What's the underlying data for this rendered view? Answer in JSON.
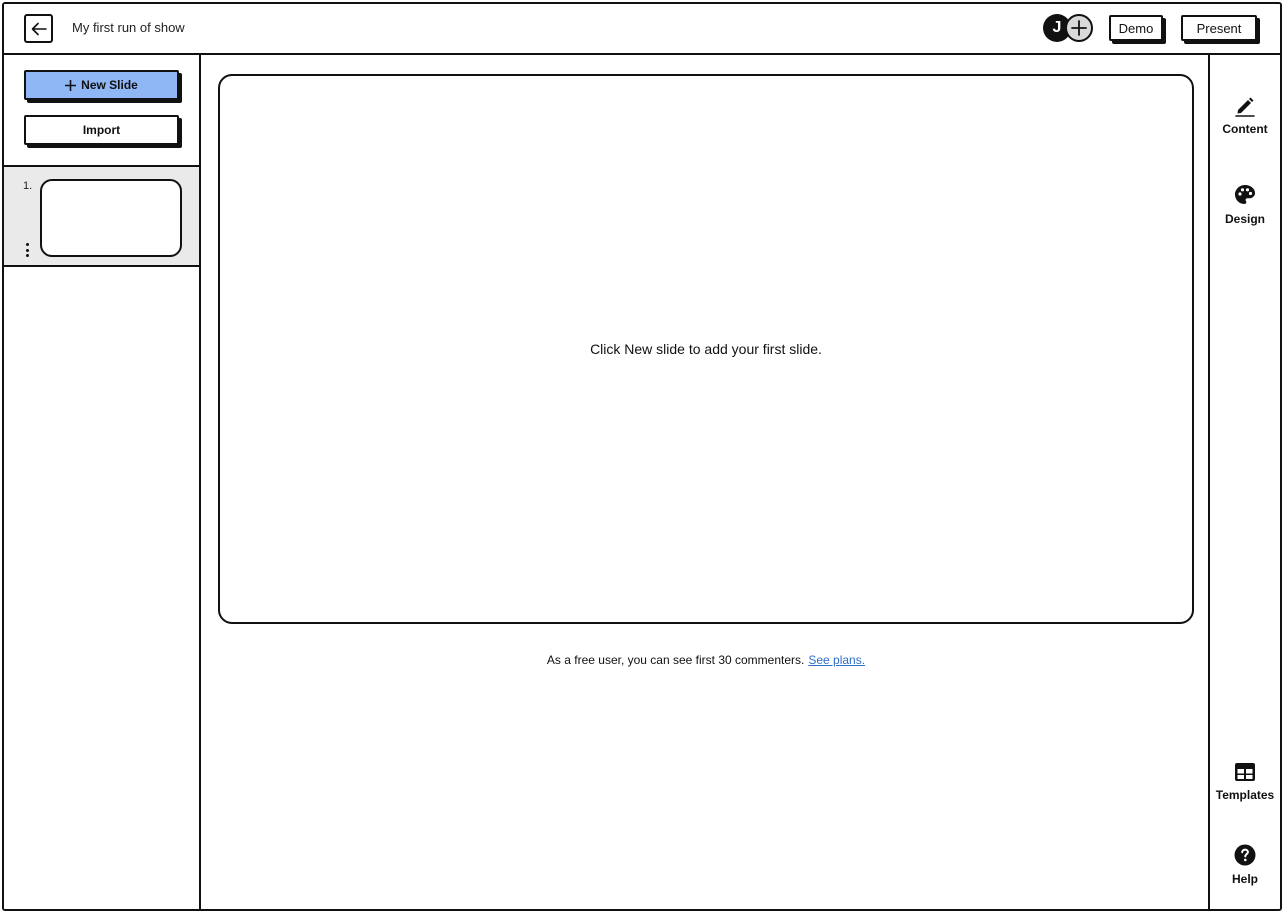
{
  "header": {
    "title": "My first run of show",
    "avatar_initial": "J",
    "demo_label": "Demo",
    "present_label": "Present"
  },
  "sidebar": {
    "new_slide_label": "New Slide",
    "import_label": "Import",
    "slides": [
      {
        "number": "1."
      }
    ]
  },
  "canvas": {
    "empty_message": "Click New slide to add your first slide."
  },
  "footer": {
    "note": "As a free user, you can see first 30 commenters.",
    "link_label": "See plans."
  },
  "rail": {
    "content_label": "Content",
    "design_label": "Design",
    "templates_label": "Templates",
    "help_label": "Help"
  },
  "colors": {
    "accent": "#8fb6f5",
    "link": "#2f6fc7",
    "ink": "#111111",
    "selected_row": "#eaeaea"
  },
  "icons": {
    "back": "arrow-left-icon",
    "add_user": "plus-circle-icon",
    "new_slide": "plus-icon",
    "content": "pencil-icon",
    "design": "palette-icon",
    "templates": "table-icon",
    "help": "question-circle-icon",
    "slide_menu": "kebab-menu-icon"
  }
}
